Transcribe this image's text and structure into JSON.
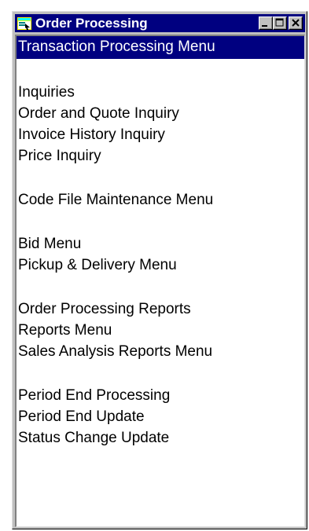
{
  "window": {
    "title": "Order Processing"
  },
  "menu": {
    "header": "Transaction Processing Menu",
    "groups": [
      [
        "Inquiries",
        "Order and Quote Inquiry",
        "Invoice History Inquiry",
        "Price Inquiry"
      ],
      [
        "Code File Maintenance Menu"
      ],
      [
        "Bid Menu",
        "Pickup & Delivery Menu"
      ],
      [
        "Order Processing Reports",
        "Reports Menu",
        "Sales Analysis Reports Menu"
      ],
      [
        "Period End Processing",
        "Period End Update",
        "Status Change Update"
      ]
    ]
  },
  "colors": {
    "titlebar": "#000080",
    "selection": "#000080",
    "face": "#c0c0c0"
  }
}
